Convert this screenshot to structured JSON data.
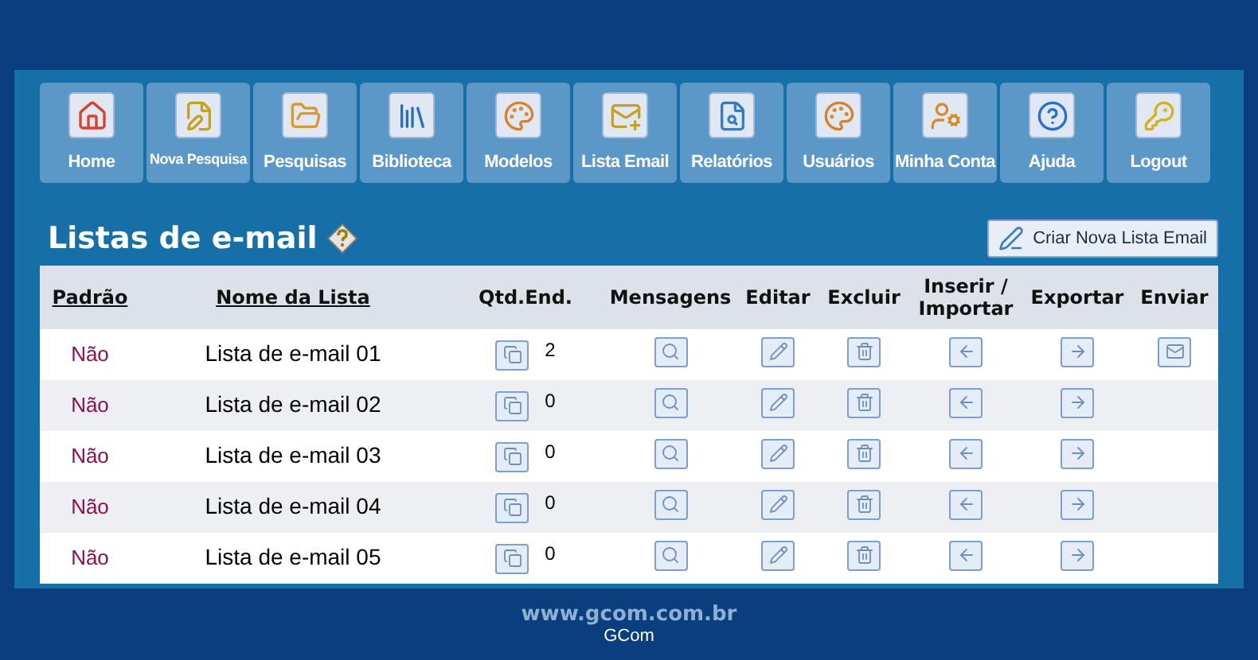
{
  "nav": [
    {
      "label": "Home"
    },
    {
      "label": "Nova Pesquisa"
    },
    {
      "label": "Pesquisas"
    },
    {
      "label": "Biblioteca"
    },
    {
      "label": "Modelos"
    },
    {
      "label": "Lista Email"
    },
    {
      "label": "Relatórios"
    },
    {
      "label": "Usuários"
    },
    {
      "label": "Minha Conta"
    },
    {
      "label": "Ajuda"
    },
    {
      "label": "Logout"
    }
  ],
  "page_title": "Listas de e-mail",
  "create_button": "Criar Nova Lista Email",
  "table": {
    "columns": [
      "Padrão",
      "Nome da Lista",
      "Qtd.End.",
      "Mensagens",
      "Editar",
      "Excluir",
      "Inserir / Importar",
      "Exportar",
      "Enviar"
    ],
    "rows": [
      {
        "default": "Não",
        "name": "Lista de e-mail 01",
        "count": "2",
        "can_send": true
      },
      {
        "default": "Não",
        "name": "Lista de e-mail 02",
        "count": "0",
        "can_send": false
      },
      {
        "default": "Não",
        "name": "Lista de e-mail 03",
        "count": "0",
        "can_send": false
      },
      {
        "default": "Não",
        "name": "Lista de e-mail 04",
        "count": "0",
        "can_send": false
      },
      {
        "default": "Não",
        "name": "Lista de e-mail 05",
        "count": "0",
        "can_send": false
      }
    ]
  },
  "footer": {
    "site": "www.gcom.com.br",
    "company": "GCom"
  }
}
